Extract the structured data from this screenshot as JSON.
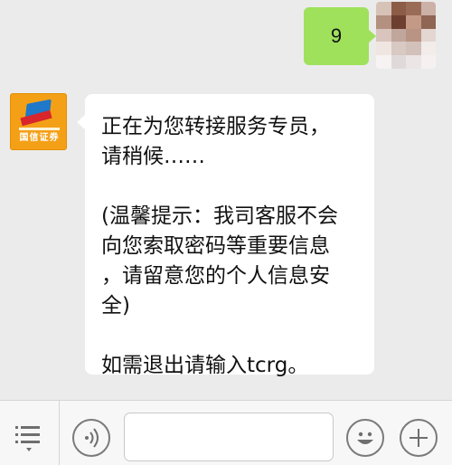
{
  "chat": {
    "outgoing": {
      "text": "9"
    },
    "incoming": {
      "sender_logo_text": "国信证券",
      "lines": [
        "正在为您转接服务专员，",
        "请稍候……",
        "",
        "(温馨提示：我司客服不会",
        "向您索取密码等重要信息",
        "，请留意您的个人信息安",
        "全)",
        "",
        "如需退出请输入tcrg。"
      ]
    }
  },
  "input_bar": {
    "menu_icon": "list-icon",
    "voice_icon": "voice-wave-icon",
    "emoji_icon": "smiley-icon",
    "plus_icon": "plus-icon",
    "text_value": "",
    "placeholder": ""
  },
  "colors": {
    "background": "#ebebeb",
    "outgoing_bubble": "#9fe15b",
    "incoming_bubble": "#ffffff",
    "input_bar": "#f7f7f7",
    "logo_orange": "#f4a017",
    "logo_blue": "#1f78c8",
    "logo_red": "#d8262c"
  }
}
